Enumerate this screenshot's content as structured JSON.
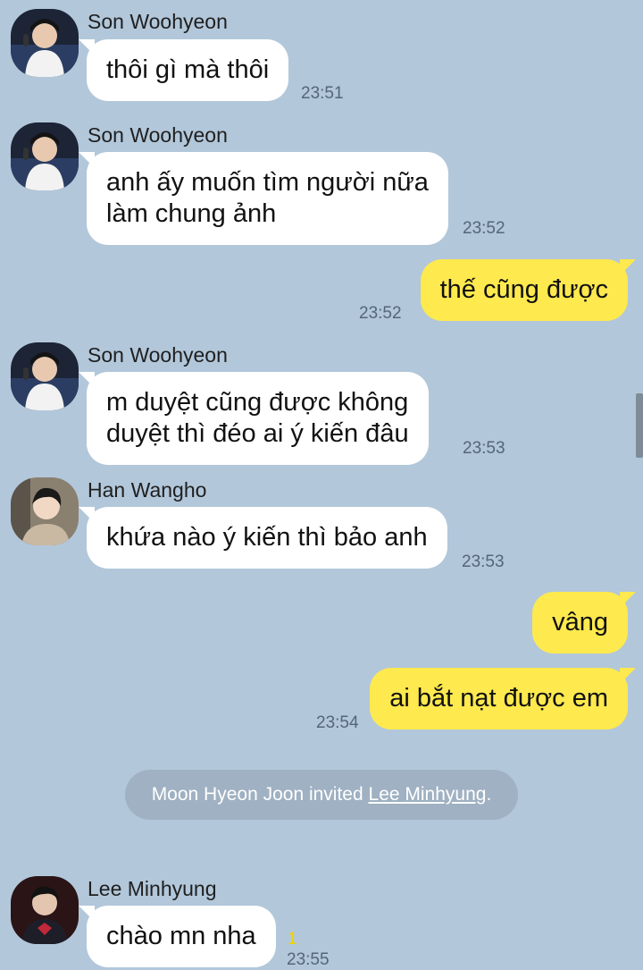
{
  "messages": [
    {
      "sender": "Son Woohyeon",
      "lines": [
        "thôi gì mà thôi"
      ],
      "time": "23:51"
    },
    {
      "sender": "Son Woohyeon",
      "lines": [
        "anh ấy muốn tìm người nữa",
        "làm chung ảnh"
      ],
      "time": "23:52"
    },
    {
      "sender": "me",
      "lines": [
        "thế cũng được"
      ],
      "time": "23:52"
    },
    {
      "sender": "Son Woohyeon",
      "lines": [
        "m duyệt cũng được không",
        "duyệt thì đéo ai ý kiến đâu"
      ],
      "time": "23:53"
    },
    {
      "sender": "Han Wangho",
      "lines": [
        "khứa nào ý kiến thì bảo anh"
      ],
      "time": "23:53"
    },
    {
      "sender": "me",
      "lines": [
        "vâng"
      ],
      "time": ""
    },
    {
      "sender": "me",
      "lines": [
        "ai bắt nạt được em"
      ],
      "time": "23:54"
    },
    {
      "sender": "Lee Minhyung",
      "lines": [
        "chào mn nha"
      ],
      "time": "23:55",
      "unread": "1"
    }
  ],
  "system_notice": {
    "prefix": "Moon Hyeon Joon invited ",
    "invitee": "Lee Minhyung ",
    "suffix": "."
  },
  "colors": {
    "background": "#b2c7da",
    "incoming_bubble": "#ffffff",
    "outgoing_bubble": "#fee94e",
    "unread_count": "#f2d400"
  }
}
